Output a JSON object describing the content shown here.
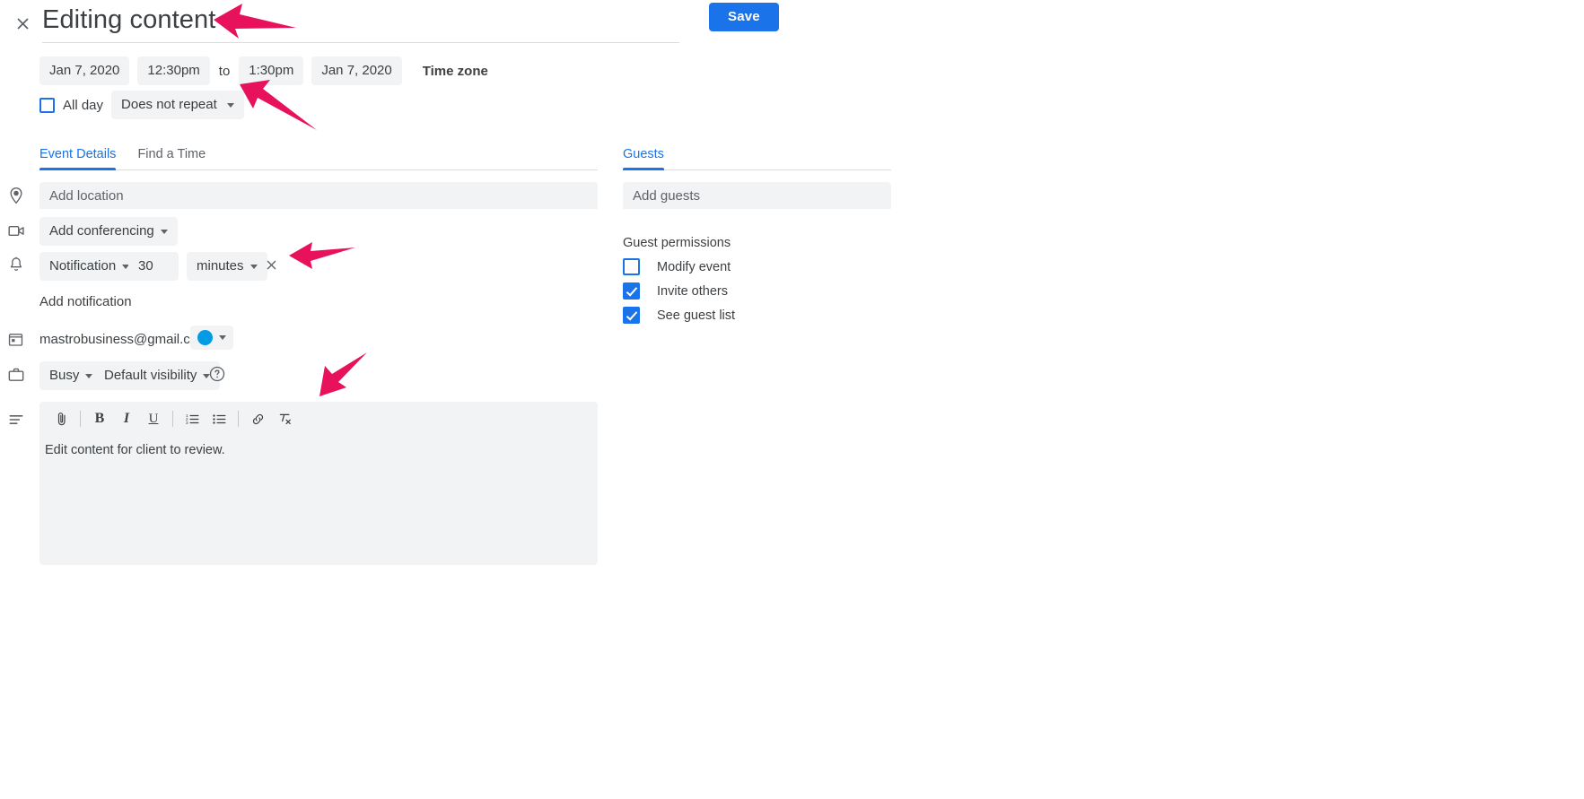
{
  "window": {
    "close_icon": "close-icon",
    "title": "Editing content",
    "save_label": "Save"
  },
  "schedule": {
    "start_date": "Jan 7, 2020",
    "start_time": "12:30pm",
    "to_label": "to",
    "end_time": "1:30pm",
    "end_date": "Jan 7, 2020",
    "timezone_label": "Time zone",
    "all_day_label": "All day",
    "all_day_checked": false,
    "repeat_label": "Does not repeat"
  },
  "left_panel": {
    "tabs": [
      {
        "label": "Event Details",
        "active": true
      },
      {
        "label": "Find a Time",
        "active": false
      }
    ],
    "location": {
      "icon": "location-pin-icon",
      "placeholder": "Add location",
      "value": ""
    },
    "conferencing": {
      "icon": "video-camera-icon",
      "label": "Add conferencing"
    },
    "notification": {
      "icon": "bell-icon",
      "type_label": "Notification",
      "amount": "30",
      "unit_label": "minutes",
      "remove_icon": "close-icon",
      "add_label": "Add notification"
    },
    "calendar": {
      "icon": "calendar-icon",
      "email": "mastrobusiness@gmail.com",
      "color": "#039be5",
      "color_dot_icon": "color-dot-icon"
    },
    "availability": {
      "icon": "briefcase-icon",
      "busy_label": "Busy",
      "visibility_label": "Default visibility",
      "help_icon": "help-circle-icon"
    },
    "description": {
      "icon": "description-lines-icon",
      "toolbar": [
        {
          "icon": "attachment-icon",
          "name": "attach-file"
        },
        {
          "icon": "bold-icon",
          "name": "bold"
        },
        {
          "icon": "italic-icon",
          "name": "italic"
        },
        {
          "icon": "underline-icon",
          "name": "underline"
        },
        {
          "icon": "numbered-list-icon",
          "name": "numbered-list"
        },
        {
          "icon": "bulleted-list-icon",
          "name": "bulleted-list"
        },
        {
          "icon": "link-icon",
          "name": "insert-link"
        },
        {
          "icon": "remove-formatting-icon",
          "name": "remove-formatting"
        }
      ],
      "text": "Edit content for client to review."
    }
  },
  "right_panel": {
    "tabs": [
      {
        "label": "Guests",
        "active": true
      }
    ],
    "guests_placeholder": "Add guests",
    "permissions_title": "Guest permissions",
    "permissions": [
      {
        "label": "Modify event",
        "checked": false
      },
      {
        "label": "Invite others",
        "checked": true
      },
      {
        "label": "See guest list",
        "checked": true
      }
    ]
  },
  "theme": {
    "accent": "#1a73e8",
    "annotation_color": "#e8115b",
    "field_bg": "#f1f3f4",
    "text": "#3c4043",
    "muted_text": "#5f6368"
  },
  "annotations": [
    {
      "name": "arrow-title",
      "points_at": "title"
    },
    {
      "name": "arrow-end-date",
      "points_at": "end-date-chip"
    },
    {
      "name": "arrow-notification",
      "points_at": "notification-row"
    },
    {
      "name": "arrow-description",
      "points_at": "description-editor"
    }
  ]
}
